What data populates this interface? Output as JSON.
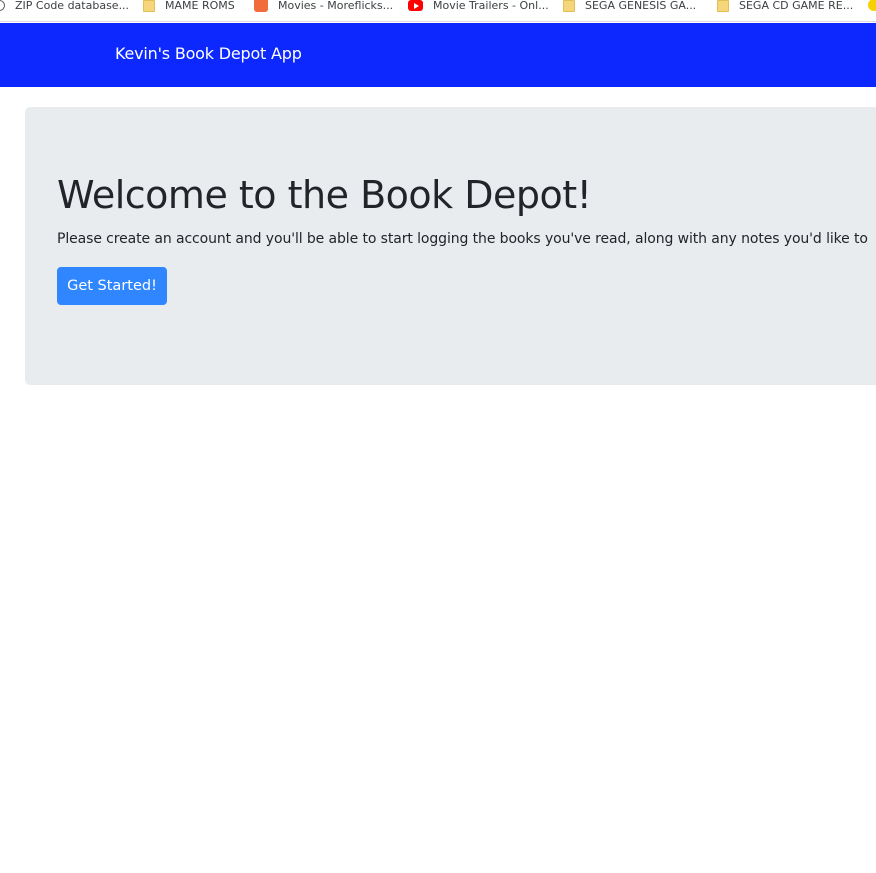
{
  "bookmarks": [
    {
      "label": "ZIP Code database...",
      "icon": "globe-icon"
    },
    {
      "label": "MAME ROMS",
      "icon": "folder-icon"
    },
    {
      "label": "Movies - Moreflicks...",
      "icon": "moreflicks-icon"
    },
    {
      "label": "Movie Trailers - Onl...",
      "icon": "youtube-icon"
    },
    {
      "label": "SEGA GENESIS GA...",
      "icon": "folder-icon"
    },
    {
      "label": "SEGA CD GAME RE...",
      "icon": "folder-icon"
    },
    {
      "label": "",
      "icon": "smiley-icon"
    }
  ],
  "navbar": {
    "brand": "Kevin's Book Depot App",
    "background": "#0d28ff"
  },
  "jumbotron": {
    "title": "Welcome to the Book Depot!",
    "lead": "Please create an account and you'll be able to start logging the books you've read, along with any notes you'd like to",
    "button_label": "Get Started!",
    "background": "#e9ecef"
  },
  "colors": {
    "primary_button": "#2f86ff",
    "text": "#212529"
  }
}
